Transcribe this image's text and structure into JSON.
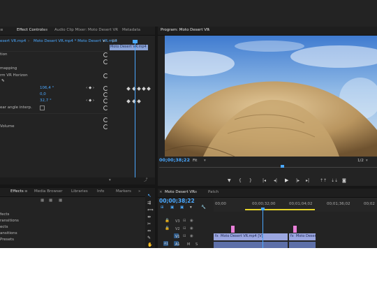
{
  "effect_controls": {
    "tabs": [
      "Effect Controls",
      "Audio Clip Mixer: Moto Desert VR",
      "Metadata"
    ],
    "clip_path": "Moto Desert VR.mp4 * Moto Desert VR.mp4",
    "clip_source_prefix": "esert VR.mp4",
    "clip_bar_label": "Moto Desert VR.mp4",
    "rows": [
      {
        "label": "tion"
      },
      {
        "label": "mapping"
      },
      {
        "label": "rm VR Horizon"
      },
      {
        "label": "",
        "value": "106,4 °"
      },
      {
        "label": "",
        "value": "0,0"
      },
      {
        "label": "",
        "value": "32,7 °"
      },
      {
        "label": "ear angle interp."
      },
      {
        "label": "Volume"
      }
    ]
  },
  "program_monitor": {
    "title": "Program: Moto Desert VR",
    "timecode": "00;00;38;22",
    "fit": "Fit",
    "resolution": "1/2"
  },
  "effects_panel": {
    "tabs": [
      "Effects",
      "Media Browser",
      "Libraries",
      "Info",
      "Markers"
    ],
    "items": [
      "fects",
      "ransitions",
      "ects",
      "ansitions",
      "Presets"
    ]
  },
  "timeline": {
    "tabs": [
      "Moto Desert VR",
      "Patch"
    ],
    "timecode": "00;00;38;22",
    "ruler": [
      "00;00",
      "00;00;32;00",
      "00;01;04;02",
      "00;01;36;02",
      "00;02"
    ],
    "tracks": [
      {
        "name": "V3"
      },
      {
        "name": "V2"
      },
      {
        "name": "V1"
      },
      {
        "name": "A1",
        "source": "A1",
        "m": "M",
        "s": "S"
      }
    ],
    "clips": [
      "Moto Desert VR.mp4 [V]",
      "Moto Deser"
    ],
    "fx_label": "fx"
  },
  "colors": {
    "accent": "#4aa8ff",
    "panel": "#232323",
    "clip_video": "#9aa6e0",
    "clip_audio": "#5d6fa8",
    "marker": "#e87fd8"
  }
}
